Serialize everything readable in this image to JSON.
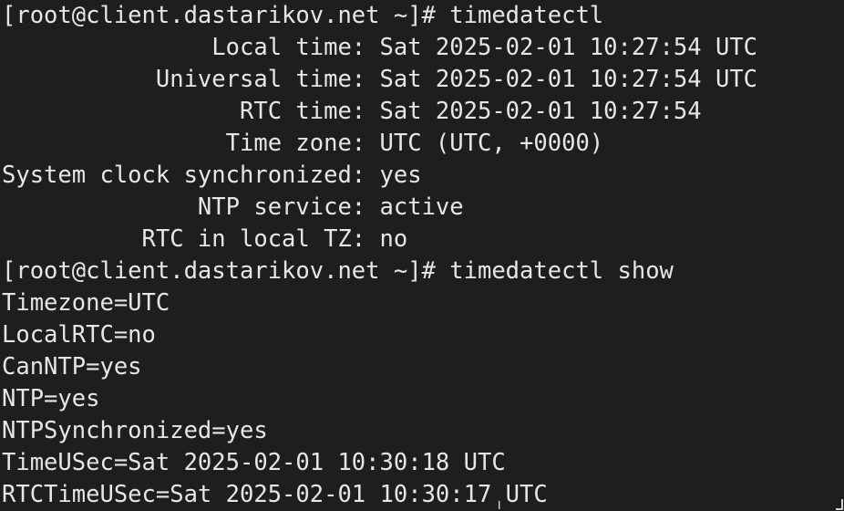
{
  "terminal": {
    "lines": [
      "[root@client.dastarikov.net ~]# timedatectl",
      "               Local time: Sat 2025-02-01 10:27:54 UTC",
      "           Universal time: Sat 2025-02-01 10:27:54 UTC",
      "                 RTC time: Sat 2025-02-01 10:27:54",
      "                Time zone: UTC (UTC, +0000)",
      "System clock synchronized: yes",
      "              NTP service: active",
      "          RTC in local TZ: no",
      "[root@client.dastarikov.net ~]# timedatectl show",
      "Timezone=UTC",
      "LocalRTC=no",
      "CanNTP=yes",
      "NTP=yes",
      "NTPSynchronized=yes",
      "TimeUSec=Sat 2025-02-01 10:30:18 UTC",
      "RTCTimeUSec=Sat 2025-02-01 10:30:17 UTC"
    ],
    "background_color": "#1e1e1e",
    "text_color": "#e6e6e6"
  },
  "icons": {
    "mouse_cursor": "ibeam-cursor-icon",
    "resize": "resize-grip-icon"
  }
}
